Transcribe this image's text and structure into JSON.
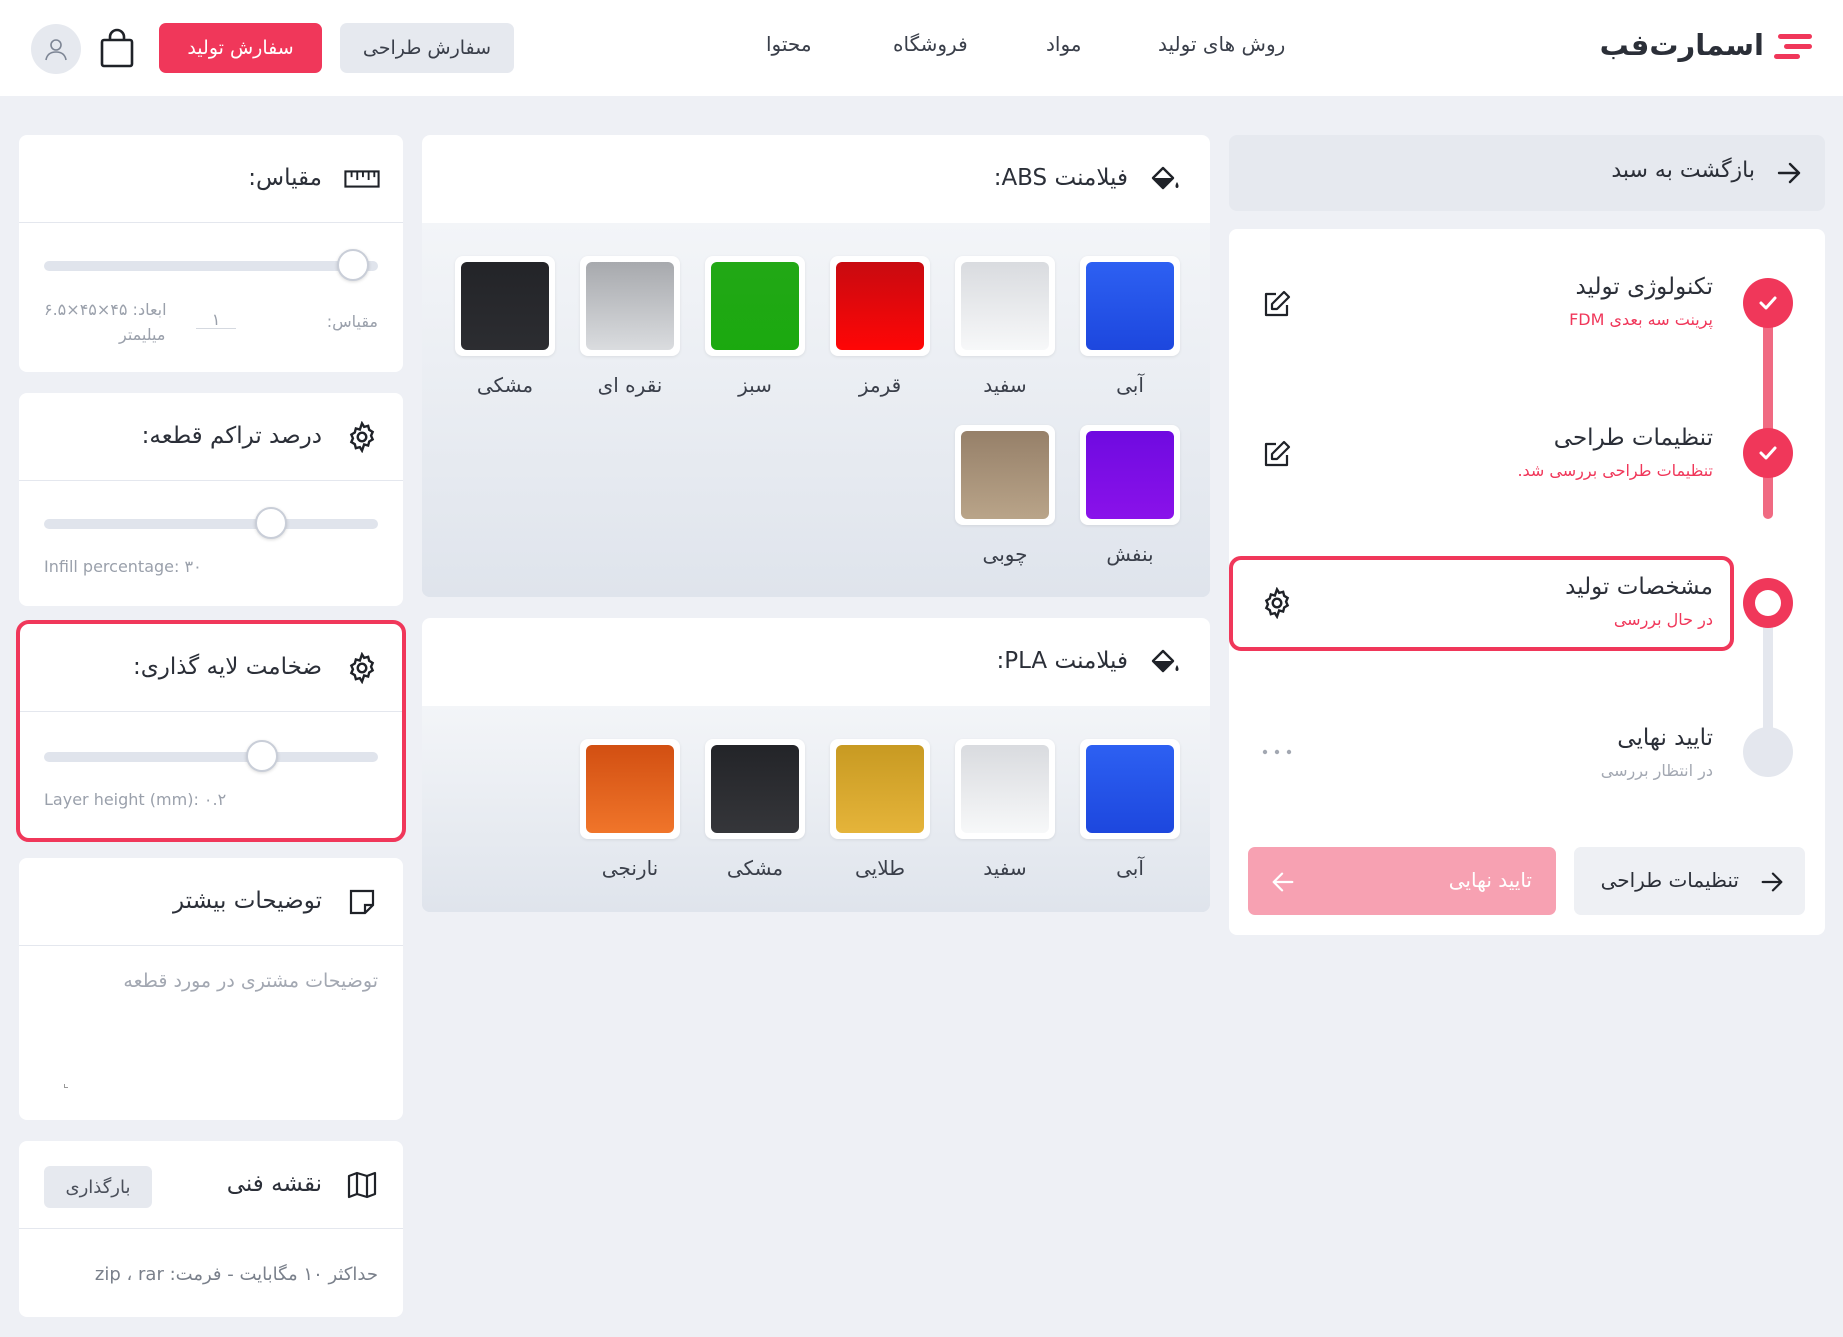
{
  "header": {
    "logo_text": "اسمارت‌فب",
    "nav": [
      "روش های تولید",
      "مواد",
      "فروشگاه",
      "محتوا"
    ],
    "design_order": "سفارش طراحی",
    "production_order": "سفارش تولید",
    "cart_icon": "shopping-bag-icon",
    "avatar_icon": "user-icon"
  },
  "left": {
    "scale": {
      "title": "مقیاس:",
      "icon": "ruler-icon",
      "value": 1,
      "scale_label": "مقیاس:",
      "scale_value": "۱",
      "dims_label": "ابعاد: ۴۵×۴۵×۶.۵",
      "dims_unit": "میلیمتر"
    },
    "infill": {
      "title": "درصد تراکم قطعه:",
      "icon": "gear-icon",
      "value_fraction": 0.66,
      "hint": "Infill percentage: ۳۰"
    },
    "layer": {
      "title": "ضخامت لایه گذاری:",
      "icon": "gear-icon",
      "value_fraction": 0.64,
      "hint": "Layer height (mm): ۰.۲"
    },
    "notes": {
      "title": "توضیحات بیشتر",
      "icon": "note-icon",
      "placeholder": "توضیحات مشتری در مورد قطعه"
    },
    "drawing": {
      "title": "نقشه فنی",
      "icon": "map-icon",
      "upload": "بارگذاری",
      "hint": "حداکثر ۱۰ مگابایت - فرمت: zip ، rar"
    }
  },
  "abs": {
    "title": "فیلامنت ABS:",
    "icon": "paint-bucket-icon",
    "colors": [
      {
        "name": "آبی",
        "color": "#1f4ee8"
      },
      {
        "name": "سفید",
        "color": "#eceef1"
      },
      {
        "name": "قرمز",
        "color": "#e8070b"
      },
      {
        "name": "سبز",
        "color": "#1fa814"
      },
      {
        "name": "نقره ای",
        "color": "#b7b9bd"
      },
      {
        "name": "مشکی",
        "color": "#26272b"
      },
      {
        "name": "بنفش",
        "color": "#7a0ee2"
      },
      {
        "name": "چوبی",
        "color": "#a88f74"
      }
    ]
  },
  "pla": {
    "title": "فیلامنت PLA:",
    "icon": "paint-bucket-icon",
    "colors": [
      {
        "name": "آبی",
        "color": "#1f4ee8"
      },
      {
        "name": "سفید",
        "color": "#eceef1"
      },
      {
        "name": "طلایی",
        "color": "#d9a52a"
      },
      {
        "name": "مشکی",
        "color": "#26272b"
      },
      {
        "name": "نارنجی",
        "color": "#e6611a"
      }
    ]
  },
  "right": {
    "back": "بازگشت به سبد",
    "steps": [
      {
        "title": "تکنولوژی تولید",
        "subtitle": "پرینت سه بعدی FDM",
        "status": "done",
        "action_icon": "edit-icon"
      },
      {
        "title": "تنظیمات طراحی",
        "subtitle": "تنظیمات طراحی بررسی شد.",
        "status": "done",
        "action_icon": "edit-icon"
      },
      {
        "title": "مشخصات تولید",
        "subtitle": "در حال بررسی",
        "status": "current",
        "action_icon": "gear-icon"
      },
      {
        "title": "تایید نهایی",
        "subtitle": "در انتظار بررسی",
        "status": "pending",
        "action_icon": "more-icon"
      }
    ],
    "prev_button": "تنظیمات طراحی",
    "next_button": "تایید نهایی"
  },
  "colors": {
    "accent": "#f0375a",
    "accent_light": "#f7a1b2",
    "background": "#eef0f5"
  }
}
